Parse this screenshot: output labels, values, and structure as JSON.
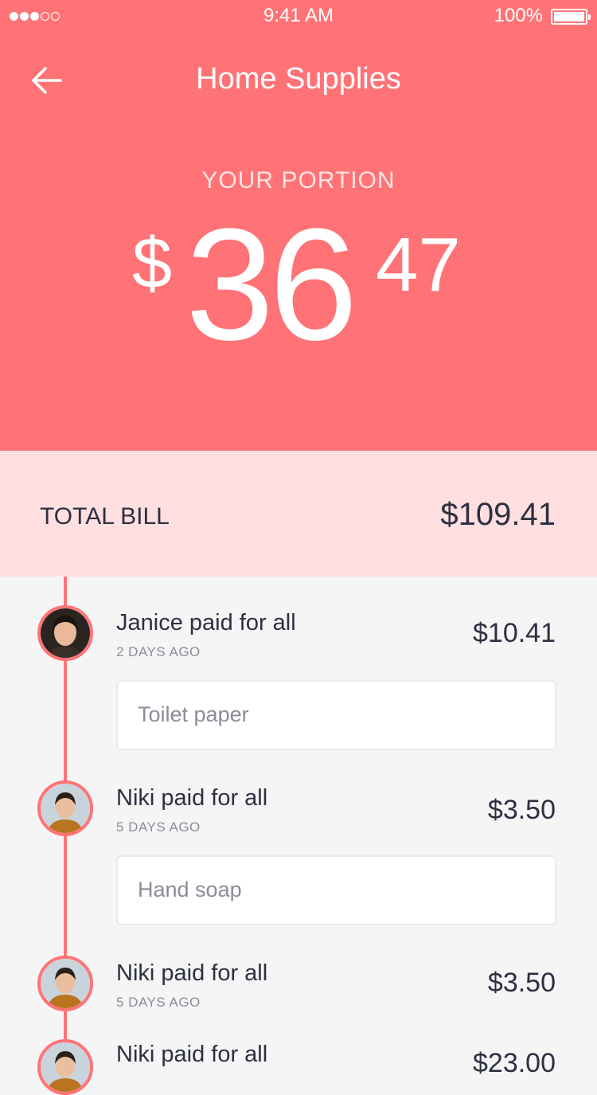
{
  "status_bar": {
    "time": "9:41 AM",
    "battery_percent": "100%",
    "signal_bars_filled": 3,
    "signal_bars_total": 5
  },
  "header": {
    "title": "Home Supplies",
    "back_icon": "arrow-left-icon"
  },
  "portion": {
    "label": "YOUR PORTION",
    "currency": "$",
    "dollars": "36",
    "cents": "47"
  },
  "total_bill": {
    "label": "TOTAL BILL",
    "value": "$109.41"
  },
  "payments": [
    {
      "payer": "Janice paid for all",
      "when": "2 DAYS AGO",
      "amount": "$10.41",
      "note": "Toilet paper"
    },
    {
      "payer": "Niki paid for all",
      "when": "5 DAYS AGO",
      "amount": "$3.50",
      "note": "Hand soap"
    },
    {
      "payer": "Niki paid for all",
      "when": "5 DAYS AGO",
      "amount": "$3.50"
    },
    {
      "payer": "Niki paid for all",
      "amount": "$23.00"
    }
  ],
  "colors": {
    "accent": "#ff7376",
    "total_bg": "#ffdfe0",
    "text_dark": "#2c3040",
    "text_muted": "#8a8d99",
    "list_bg": "#f5f5f5"
  }
}
